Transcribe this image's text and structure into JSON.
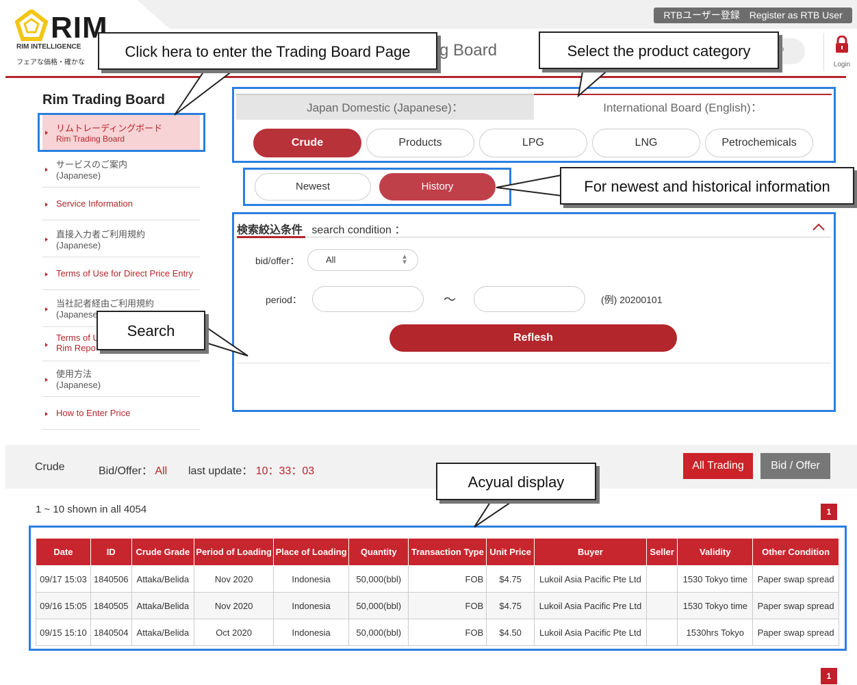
{
  "header": {
    "register_label": "RTBユーザー登録　Register as RTB User",
    "logo_text": "RIM",
    "logo_sub": "RIM INTELLIGENCE",
    "logo_tagline": "フェアな価格・確かな",
    "title_peek": "ding Board",
    "top_pill": "P",
    "login_label": "Login"
  },
  "sidebar": {
    "title": "Rim Trading Board",
    "items": [
      {
        "l1": "リムトレーディングボード",
        "l2": "Rim Trading Board"
      },
      {
        "l1": "サービスのご案内",
        "l2": "(Japanese)"
      },
      {
        "l1": "Service Information"
      },
      {
        "l1": "直接入力者ご利用規約",
        "l2": "(Japanese)"
      },
      {
        "l1": "Terms of Use for Direct Price Entry"
      },
      {
        "l1": "当社記者経由ご利用規約",
        "l2": "(Japanese)"
      },
      {
        "l1": "Terms of U",
        "l2": "Rim Repo"
      },
      {
        "l1": "使用方法",
        "l2": "(Japanese)"
      },
      {
        "l1": "How to Enter Price"
      }
    ]
  },
  "board_tabs": {
    "japan": "Japan Domestic (Japanese)：",
    "international": "International Board (English)："
  },
  "categories": [
    "Crude",
    "Products",
    "LPG",
    "LNG",
    "Petrochemicals"
  ],
  "view_tabs": [
    "Newest",
    "History"
  ],
  "search": {
    "title_jp": "検索絞込条件",
    "title_en": "search condition ：",
    "bid_offer_label": "bid/offer：",
    "bid_offer_value": "All",
    "period_label": "period：",
    "tilde": "～",
    "example": "(例) 20200101",
    "refresh_label": "Reflesh"
  },
  "results": {
    "product": "Crude",
    "bid_offer_label": "Bid/Offer：",
    "bid_offer_value": "All",
    "last_update_label": "last update：",
    "last_update_value": "10：33：03",
    "all_trading_label": "All Trading",
    "bid_offer_button": "Bid / Offer",
    "shown_text": "1 ~ 10 shown in all 4054",
    "page": "1"
  },
  "table": {
    "headers": [
      "Date",
      "ID",
      "Crude Grade",
      "Period of Loading",
      "Place of Loading",
      "Quantity",
      "Transaction Type",
      "Unit Price",
      "Buyer",
      "Seller",
      "Validity",
      "Other Condition"
    ],
    "rows": [
      [
        "09/17 15:03",
        "1840506",
        "Attaka/Belida",
        "Nov 2020",
        "Indonesia",
        "50,000(bbl)",
        "FOB",
        "$4.75",
        "Lukoil Asia Pacific Pte Ltd",
        "",
        "1530 Tokyo time",
        "Paper swap spread"
      ],
      [
        "09/16 15:05",
        "1840505",
        "Attaka/Belida",
        "Nov 2020",
        "Indonesia",
        "50,000(bbl)",
        "FOB",
        "$4.75",
        "Lukoil Asia Pacific Pre Ltd",
        "",
        "1530 Tokyo time",
        "Paper swap spread"
      ],
      [
        "09/15 15:10",
        "1840504",
        "Attaka/Belida",
        "Oct 2020",
        "Indonesia",
        "50,000(bbl)",
        "FOB",
        "$4.50",
        "Lukoil Asia Pacific Pte Ltd",
        "",
        "1530hrs Tokyo",
        "Paper swap spread"
      ]
    ]
  },
  "annotations": {
    "trading_board": "Click hera to enter the Trading Board Page",
    "category": "Select the product category",
    "newest_history": "For newest and historical information",
    "search": "Search",
    "display": "Acyual display"
  },
  "colors": {
    "brand_red": "#b3262b",
    "highlight_blue": "#2a7fe0",
    "logo_yellow": "#f3c613"
  }
}
